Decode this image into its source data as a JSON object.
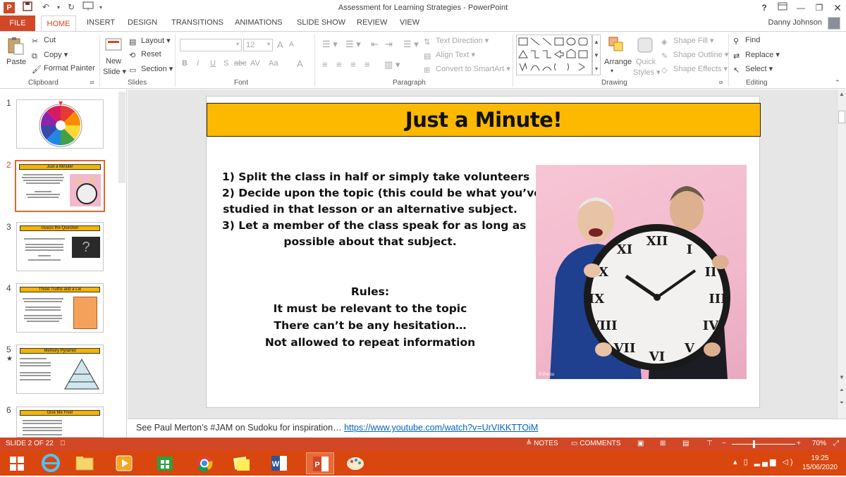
{
  "window": {
    "title": "Assessment for Learning Strategies - PowerPoint",
    "help": "?",
    "user": "Danny Johnson"
  },
  "tabs": [
    "FILE",
    "HOME",
    "INSERT",
    "DESIGN",
    "TRANSITIONS",
    "ANIMATIONS",
    "SLIDE SHOW",
    "REVIEW",
    "VIEW"
  ],
  "ribbon": {
    "clipboard": {
      "paste": "Paste",
      "cut": "Cut",
      "copy": "Copy",
      "format_painter": "Format Painter",
      "label": "Clipboard"
    },
    "slides": {
      "new_slide_1": "New",
      "new_slide_2": "Slide",
      "layout": "Layout",
      "reset": "Reset",
      "section": "Section",
      "label": "Slides"
    },
    "font": {
      "size": "12",
      "bold": "B",
      "italic": "I",
      "underline": "U",
      "shadow": "S",
      "strike": "abc",
      "spacing": "AV",
      "case": "Aa",
      "color": "A",
      "grow": "A",
      "shrink": "A",
      "label": "Font"
    },
    "paragraph": {
      "text_direction": "Text Direction",
      "align_text": "Align Text",
      "smartart": "Convert to SmartArt",
      "label": "Paragraph"
    },
    "drawing": {
      "arrange": "Arrange",
      "quick_1": "Quick",
      "quick_2": "Styles",
      "shape_fill": "Shape Fill",
      "shape_outline": "Shape Outline",
      "shape_effects": "Shape Effects",
      "label": "Drawing"
    },
    "editing": {
      "find": "Find",
      "replace": "Replace",
      "select": "Select",
      "label": "Editing"
    }
  },
  "thumbnails": [
    {
      "num": "1",
      "title": ""
    },
    {
      "num": "2",
      "title": "Just a Minute!"
    },
    {
      "num": "3",
      "title": "Guess the Question"
    },
    {
      "num": "4",
      "title": "Three Truths and a Lie"
    },
    {
      "num": "5",
      "title": "Memory Pyramid",
      "star": "★"
    },
    {
      "num": "6",
      "title": "Give Me Five!"
    }
  ],
  "slide": {
    "title": "Just a Minute!",
    "lines": [
      "1) Split the class in half or simply take volunteers",
      "2) Decide upon the topic (this could be what you’ve",
      "studied in that lesson or an alternative subject.",
      "3) Let a member of the class speak for as long as",
      "possible about that subject."
    ],
    "rules": [
      "Rules:",
      "It must be relevant to the topic",
      "There can’t be any hesitation…",
      "Not allowed to repeat information"
    ],
    "photo_credit": "© Perou"
  },
  "notes": {
    "text": "See Paul Merton’s #JAM on Sudoku for inspiration… ",
    "link": "https://www.youtube.com/watch?v=UrVIKKTTOiM"
  },
  "status": {
    "slide": "SLIDE 2 OF 22",
    "notes": "NOTES",
    "comments": "COMMENTS",
    "zoom": "70%"
  },
  "taskbar": {
    "time": "19:25",
    "date": "15/06/2020"
  },
  "colors": {
    "accent": "#d24726",
    "title_bar": "#fcb900",
    "taskbar": "#d9460e",
    "link": "#0563c1"
  }
}
